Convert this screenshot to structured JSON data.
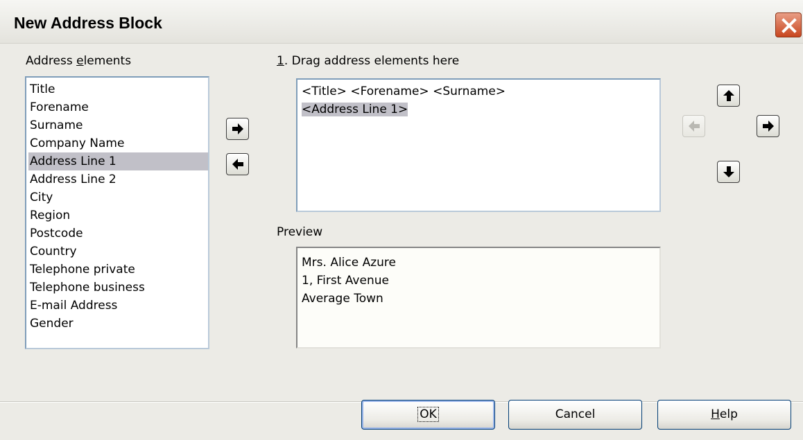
{
  "window": {
    "title": "New Address Block"
  },
  "left": {
    "label_pre": "Address ",
    "label_ul": "e",
    "label_post": "lements",
    "items": [
      "Title",
      "Forename",
      "Surname",
      "Company Name",
      "Address Line 1",
      "Address Line 2",
      "City",
      "Region",
      "Postcode",
      "Country",
      "Telephone private",
      "Telephone business",
      "E-mail Address",
      "Gender"
    ],
    "selected_index": 4
  },
  "drag": {
    "label_ul": "1",
    "label_post": ". Drag address elements here",
    "line1": "<Title> <Forename> <Surname>",
    "line2": "<Address Line 1>"
  },
  "preview": {
    "label": "Preview",
    "lines": [
      "Mrs. Alice Azure",
      "1, First Avenue",
      "Average Town"
    ]
  },
  "buttons": {
    "ok": "OK",
    "cancel": "Cancel",
    "help_ul": "H",
    "help_post": "elp"
  },
  "icons": {
    "close": "close-icon",
    "add": "arrow-right-icon",
    "remove": "arrow-left-icon",
    "move_up": "arrow-up-icon",
    "move_down": "arrow-down-icon",
    "move_left": "arrow-left-icon",
    "move_right": "arrow-right-icon"
  }
}
